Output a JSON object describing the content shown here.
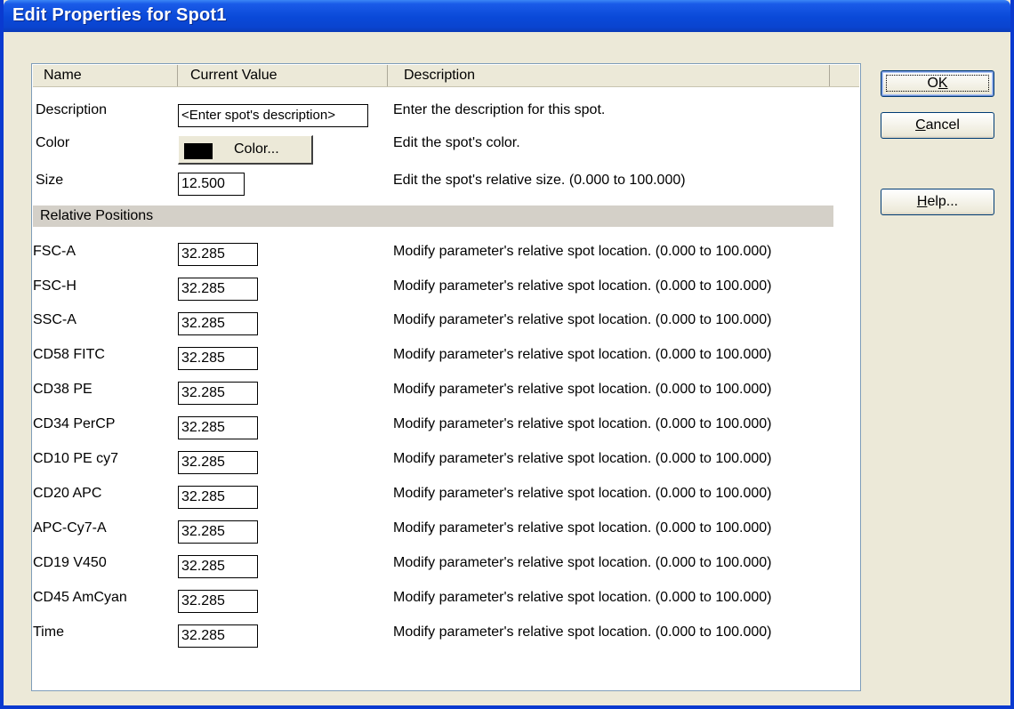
{
  "window": {
    "title": "Edit Properties for Spot1"
  },
  "columns": {
    "name": "Name",
    "value": "Current Value",
    "description": "Description"
  },
  "rows": {
    "description": {
      "name": "Description",
      "value": "<Enter spot's description>",
      "desc": "Enter the description for this spot."
    },
    "color": {
      "name": "Color",
      "button_label": "Color...",
      "swatch_color": "#000000",
      "desc": "Edit the spot's color."
    },
    "size": {
      "name": "Size",
      "value": "12.500",
      "desc": "Edit the spot's relative size. (0.000 to 100.000)"
    }
  },
  "section": {
    "label": "Relative Positions"
  },
  "params": [
    {
      "name": "FSC-A",
      "value": "32.285",
      "desc": "Modify parameter's relative spot location. (0.000 to 100.000)"
    },
    {
      "name": "FSC-H",
      "value": "32.285",
      "desc": "Modify parameter's relative spot location. (0.000 to 100.000)"
    },
    {
      "name": "SSC-A",
      "value": "32.285",
      "desc": "Modify parameter's relative spot location. (0.000 to 100.000)"
    },
    {
      "name": "CD58 FITC",
      "value": "32.285",
      "desc": "Modify parameter's relative spot location. (0.000 to 100.000)"
    },
    {
      "name": "CD38 PE",
      "value": "32.285",
      "desc": "Modify parameter's relative spot location. (0.000 to 100.000)"
    },
    {
      "name": "CD34 PerCP",
      "value": "32.285",
      "desc": "Modify parameter's relative spot location. (0.000 to 100.000)"
    },
    {
      "name": "CD10 PE cy7",
      "value": "32.285",
      "desc": "Modify parameter's relative spot location. (0.000 to 100.000)"
    },
    {
      "name": "CD20 APC",
      "value": "32.285",
      "desc": "Modify parameter's relative spot location. (0.000 to 100.000)"
    },
    {
      "name": "APC-Cy7-A",
      "value": "32.285",
      "desc": "Modify parameter's relative spot location. (0.000 to 100.000)"
    },
    {
      "name": "CD19 V450",
      "value": "32.285",
      "desc": "Modify parameter's relative spot location. (0.000 to 100.000)"
    },
    {
      "name": "CD45 AmCyan",
      "value": "32.285",
      "desc": "Modify parameter's relative spot location. (0.000 to 100.000)"
    },
    {
      "name": "Time",
      "value": "32.285",
      "desc": "Modify parameter's relative spot location. (0.000 to 100.000)"
    }
  ],
  "buttons": {
    "ok": {
      "label": "OK",
      "mnemonic": "K"
    },
    "cancel": {
      "label": "Cancel",
      "mnemonic": "C"
    },
    "help": {
      "label": "Help...",
      "mnemonic": "H"
    }
  }
}
